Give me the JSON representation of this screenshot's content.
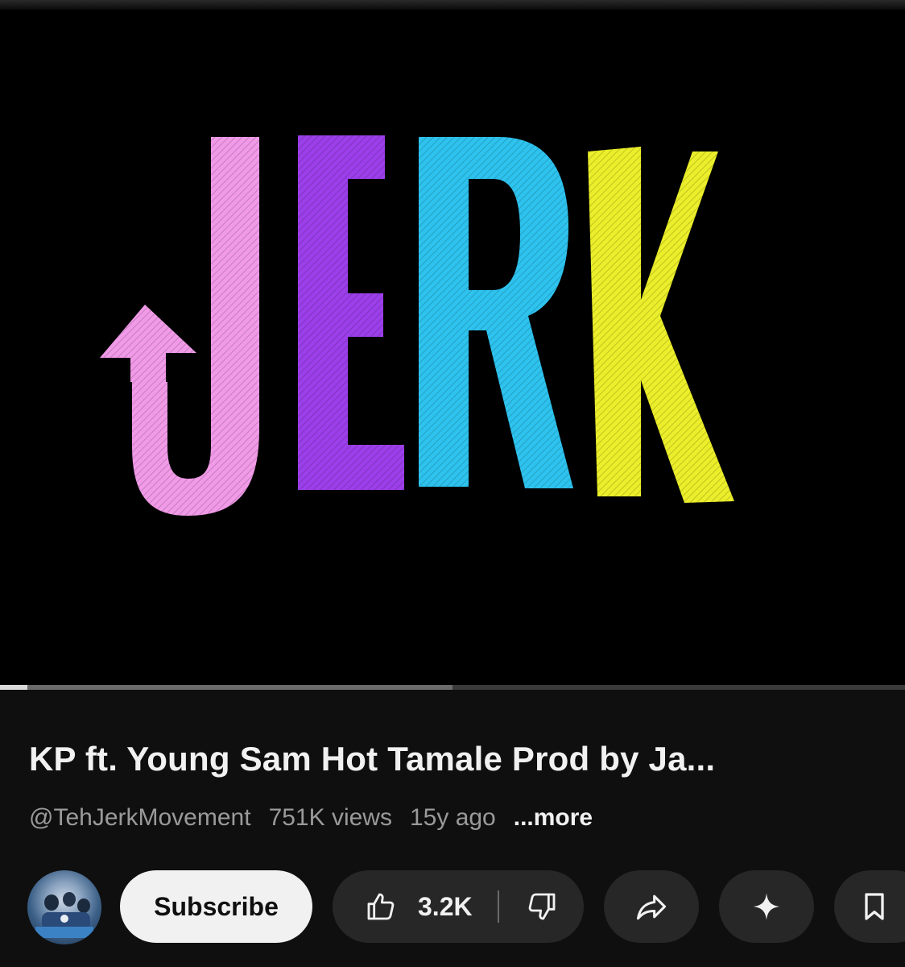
{
  "player": {
    "logo_text": "JERK",
    "logo_letter_colors": [
      "#f19ae8",
      "#9c3fea",
      "#2ec3ee",
      "#ebee2a"
    ],
    "progress_fraction": 0.03,
    "buffered_fraction": 0.5
  },
  "video": {
    "title": "KP ft. Young Sam Hot Tamale Prod by Ja...",
    "channel_handle": "@TehJerkMovement",
    "views": "751K views",
    "age": "15y ago",
    "more_label": "...more"
  },
  "actions": {
    "subscribe_label": "Subscribe",
    "like_count": "3.2K",
    "icons": {
      "like": "thumbs-up-icon",
      "dislike": "thumbs-down-icon",
      "share": "share-arrow-icon",
      "remix": "sparkle-icon",
      "save": "bookmark-icon"
    }
  },
  "colors": {
    "background": "#0f0f0f",
    "pill": "#272727",
    "subscribe_bg": "#f1f1f1",
    "muted_text": "#9a9a9a"
  }
}
